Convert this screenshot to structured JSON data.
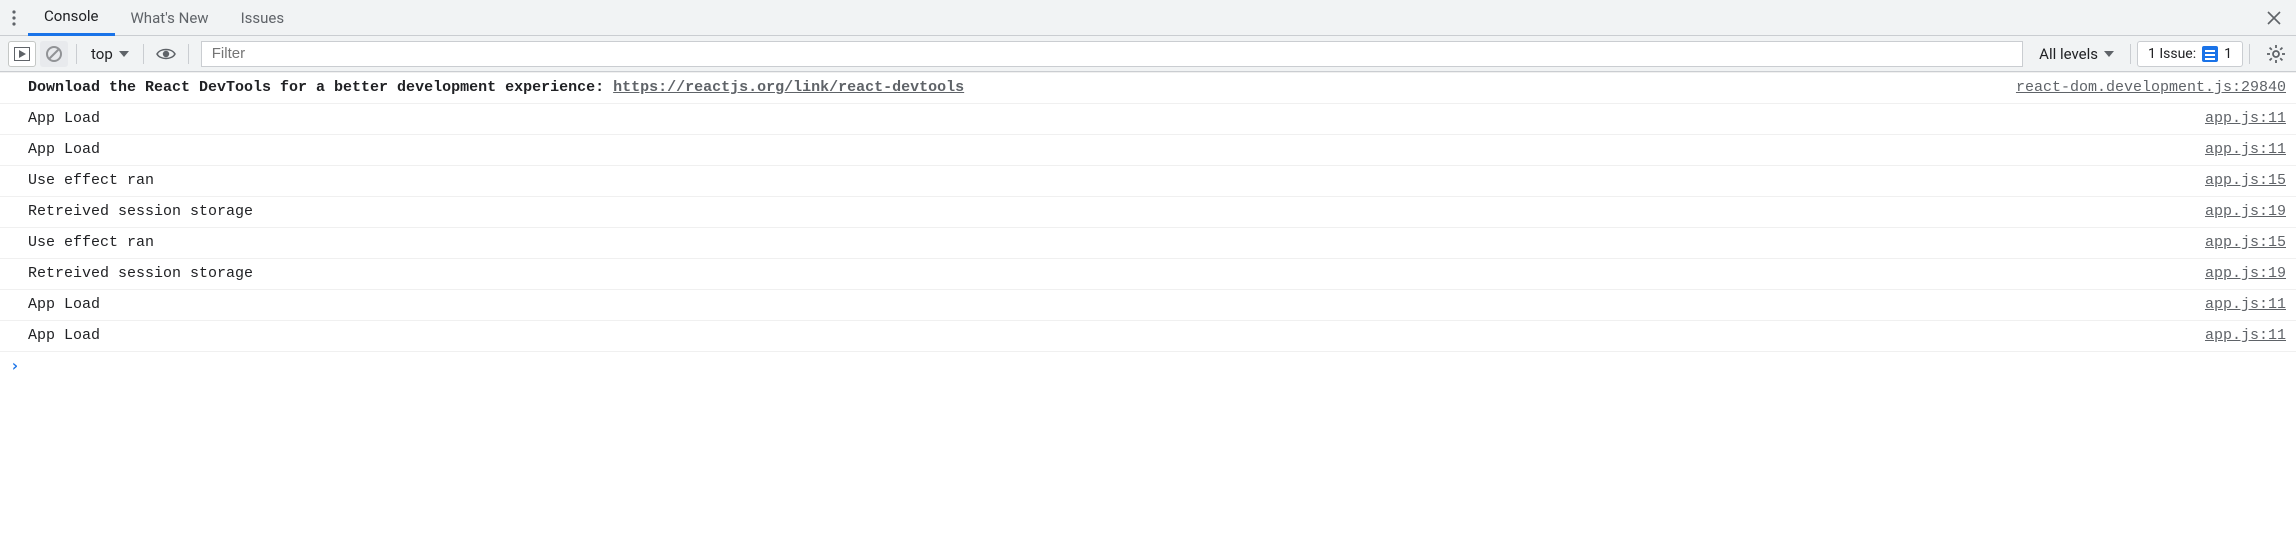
{
  "tabs": {
    "console": "Console",
    "whatsnew": "What's New",
    "issues": "Issues"
  },
  "toolbar": {
    "context": "top",
    "filter_placeholder": "Filter",
    "levels_label": "All levels",
    "issue_label": "1 Issue:",
    "issue_count": "1"
  },
  "logs": [
    {
      "msg_prefix": "Download the React DevTools for a better development experience: ",
      "link": "https://reactjs.org/link/react-devtools",
      "bold": true,
      "src": "react-dom.development.js:29840"
    },
    {
      "msg": "App Load",
      "src": "app.js:11"
    },
    {
      "msg": "App Load",
      "src": "app.js:11"
    },
    {
      "msg": "Use effect ran",
      "src": "app.js:15"
    },
    {
      "msg": "Retreived session storage",
      "src": "app.js:19"
    },
    {
      "msg": "Use effect ran",
      "src": "app.js:15"
    },
    {
      "msg": "Retreived session storage",
      "src": "app.js:19"
    },
    {
      "msg": "App Load",
      "src": "app.js:11"
    },
    {
      "msg": "App Load",
      "src": "app.js:11"
    }
  ],
  "prompt": "›"
}
